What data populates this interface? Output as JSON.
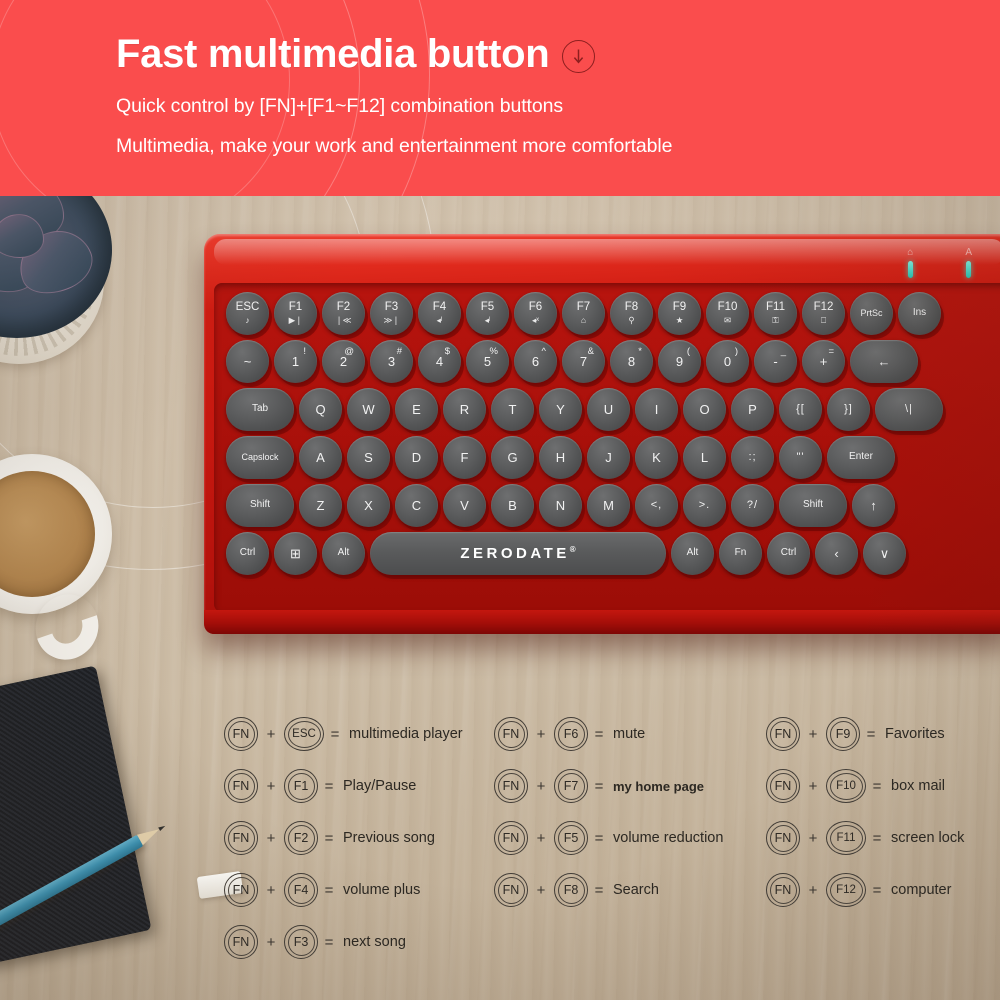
{
  "banner": {
    "headline": "Fast multimedia button",
    "down_arrow_icon": "circled-down-arrow-icon",
    "subtitle_1": "Quick control by [FN]+[F1~F12] combination buttons",
    "subtitle_2": "Multimedia, make your work and entertainment more comfortable",
    "background_color": "#fa4d4d",
    "text_color": "#ffffff"
  },
  "keyboard": {
    "brand": "ZERODATE",
    "brand_mark": "®",
    "body_color": "#c4170f",
    "key_color": "#555657",
    "indicators": [
      {
        "name": "caps-lock-indicator",
        "icon": "⌂",
        "color": "#27c5b4"
      },
      {
        "name": "num-lock-indicator",
        "icon": "A",
        "color": "#27c5b4"
      }
    ],
    "rows": [
      {
        "name": "function-row",
        "keys": [
          {
            "main": "ESC",
            "sub": "♪",
            "class": "fnkey"
          },
          {
            "main": "F1",
            "sub": "▶❘",
            "class": "fnkey"
          },
          {
            "main": "F2",
            "sub": "❘≪",
            "class": "fnkey"
          },
          {
            "main": "F3",
            "sub": "≫❘",
            "class": "fnkey"
          },
          {
            "main": "F4",
            "sub": "◂ᴵ",
            "class": "fnkey"
          },
          {
            "main": "F5",
            "sub": "◂ˡ",
            "class": "fnkey"
          },
          {
            "main": "F6",
            "sub": "◂ˣ",
            "class": "fnkey"
          },
          {
            "main": "F7",
            "sub": "⌂",
            "class": "fnkey"
          },
          {
            "main": "F8",
            "sub": "⚲",
            "class": "fnkey"
          },
          {
            "main": "F9",
            "sub": "★",
            "class": "fnkey"
          },
          {
            "main": "F10",
            "sub": "✉",
            "class": "fnkey"
          },
          {
            "main": "F11",
            "sub": "⚿",
            "class": "fnkey"
          },
          {
            "main": "F12",
            "sub": "⎕",
            "class": "fnkey"
          },
          {
            "main": "PrtSc",
            "sub": "",
            "class": "tiny-label"
          },
          {
            "main": "Ins",
            "sub": "",
            "class": "small-label"
          }
        ]
      },
      {
        "name": "number-row",
        "keys": [
          {
            "main": "~",
            "top": ""
          },
          {
            "main": "1",
            "top": "!"
          },
          {
            "main": "2",
            "top": "@"
          },
          {
            "main": "3",
            "top": "#"
          },
          {
            "main": "4",
            "top": "$"
          },
          {
            "main": "5",
            "top": "%"
          },
          {
            "main": "6",
            "top": "^"
          },
          {
            "main": "7",
            "top": "&"
          },
          {
            "main": "8",
            "top": "*"
          },
          {
            "main": "9",
            "top": "("
          },
          {
            "main": "0",
            "top": ")"
          },
          {
            "main": "-",
            "top": "_"
          },
          {
            "main": "+",
            "top": "="
          },
          {
            "main": "←",
            "top": "",
            "wide": true
          }
        ]
      },
      {
        "name": "qwerty-row",
        "keys": [
          {
            "main": "Tab",
            "wide": true,
            "class": "small-label"
          },
          {
            "main": "Q"
          },
          {
            "main": "W"
          },
          {
            "main": "E"
          },
          {
            "main": "R"
          },
          {
            "main": "T"
          },
          {
            "main": "Y"
          },
          {
            "main": "U"
          },
          {
            "main": "I"
          },
          {
            "main": "O"
          },
          {
            "main": "P"
          },
          {
            "main": "{[",
            "class": "sym"
          },
          {
            "main": "}]",
            "class": "sym"
          },
          {
            "main": "\\|",
            "wide": true,
            "class": "sym"
          }
        ]
      },
      {
        "name": "home-row",
        "keys": [
          {
            "main": "Capslock",
            "wide": true,
            "class": "tiny-label"
          },
          {
            "main": "A"
          },
          {
            "main": "S"
          },
          {
            "main": "D"
          },
          {
            "main": "F"
          },
          {
            "main": "G"
          },
          {
            "main": "H"
          },
          {
            "main": "J"
          },
          {
            "main": "K"
          },
          {
            "main": "L"
          },
          {
            "main": ":;",
            "class": "sym"
          },
          {
            "main": "\"'",
            "class": "sym"
          },
          {
            "main": "Enter",
            "wide": true,
            "class": "small-label"
          }
        ]
      },
      {
        "name": "shift-row",
        "keys": [
          {
            "main": "Shift",
            "wide": true,
            "class": "small-label"
          },
          {
            "main": "Z"
          },
          {
            "main": "X"
          },
          {
            "main": "C"
          },
          {
            "main": "V"
          },
          {
            "main": "B"
          },
          {
            "main": "N"
          },
          {
            "main": "M"
          },
          {
            "main": "<,",
            "class": "sym"
          },
          {
            "main": ">.",
            "class": "sym"
          },
          {
            "main": "?/",
            "class": "sym"
          },
          {
            "main": "Shift",
            "wide": true,
            "class": "small-label"
          },
          {
            "main": "↑"
          }
        ]
      },
      {
        "name": "bottom-row",
        "keys": [
          {
            "main": "Ctrl",
            "class": "small-label"
          },
          {
            "main": "⊞",
            "class": "win"
          },
          {
            "main": "Alt",
            "class": "small-label"
          },
          {
            "spacebar": true
          },
          {
            "main": "Alt",
            "class": "small-label"
          },
          {
            "main": "Fn",
            "class": "small-label"
          },
          {
            "main": "Ctrl",
            "class": "small-label"
          },
          {
            "main": "‹"
          },
          {
            "main": "∨"
          }
        ]
      }
    ]
  },
  "legend": {
    "columns": [
      {
        "name": "legend-column-1",
        "rows": [
          {
            "mod": "FN",
            "key": "ESC",
            "desc": "multimedia player",
            "wide": true
          },
          {
            "mod": "FN",
            "key": "F1",
            "desc": "Play/Pause"
          },
          {
            "mod": "FN",
            "key": "F2",
            "desc": "Previous song"
          },
          {
            "mod": "FN",
            "key": "F4",
            "desc": "volume plus"
          },
          {
            "mod": "FN",
            "key": "F3",
            "desc": "next song"
          }
        ]
      },
      {
        "name": "legend-column-2",
        "rows": [
          {
            "mod": "FN",
            "key": "F6",
            "desc": "mute"
          },
          {
            "mod": "FN",
            "key": "F7",
            "desc": "my home page",
            "bold": true
          },
          {
            "mod": "FN",
            "key": "F5",
            "desc": "volume reduction"
          },
          {
            "mod": "FN",
            "key": "F8",
            "desc": "Search"
          }
        ]
      },
      {
        "name": "legend-column-3",
        "rows": [
          {
            "mod": "FN",
            "key": "F9",
            "desc": "Favorites"
          },
          {
            "mod": "FN",
            "key": "F10",
            "desc": "box mail",
            "wide": true
          },
          {
            "mod": "FN",
            "key": "F11",
            "desc": "screen lock",
            "wide": true
          },
          {
            "mod": "FN",
            "key": "F12",
            "desc": "computer",
            "wide": true
          }
        ]
      }
    ],
    "plus_symbol": "+",
    "equals_symbol": "="
  },
  "scene": {
    "objects": [
      "succulent-plant",
      "coffee-mug",
      "notebook",
      "pencil",
      "eraser",
      "wooden-desk"
    ]
  }
}
